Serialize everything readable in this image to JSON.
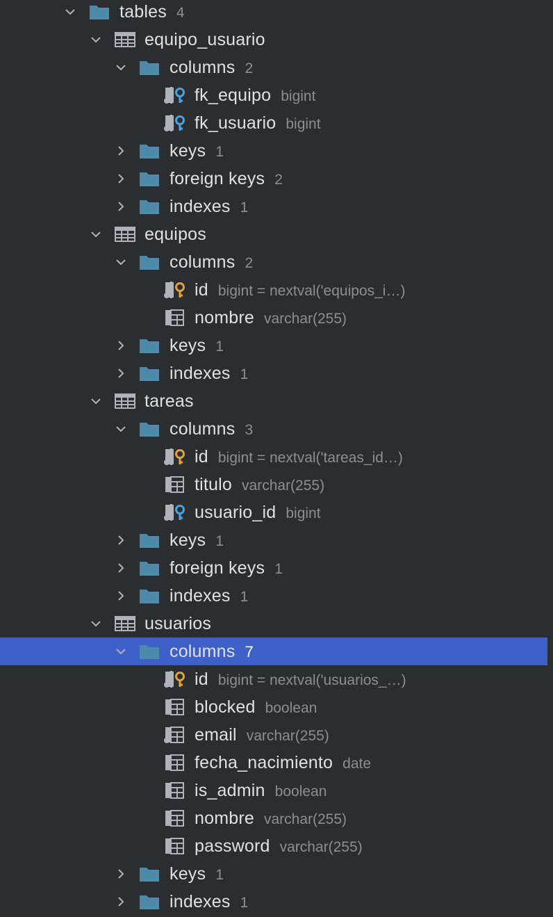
{
  "tree": [
    {
      "level": 0,
      "kind": "folder",
      "expanded": true,
      "name": "tables",
      "meta": "4"
    },
    {
      "level": 1,
      "kind": "table",
      "expanded": true,
      "name": "equipo_usuario",
      "meta": ""
    },
    {
      "level": 2,
      "kind": "folder",
      "expanded": true,
      "name": "columns",
      "meta": "2"
    },
    {
      "level": 3,
      "kind": "col-fk",
      "name": "fk_equipo",
      "meta": "bigint"
    },
    {
      "level": 3,
      "kind": "col-fk",
      "name": "fk_usuario",
      "meta": "bigint"
    },
    {
      "level": 2,
      "kind": "folder",
      "expanded": false,
      "name": "keys",
      "meta": "1"
    },
    {
      "level": 2,
      "kind": "folder",
      "expanded": false,
      "name": "foreign keys",
      "meta": "2"
    },
    {
      "level": 2,
      "kind": "folder",
      "expanded": false,
      "name": "indexes",
      "meta": "1"
    },
    {
      "level": 1,
      "kind": "table",
      "expanded": true,
      "name": "equipos",
      "meta": ""
    },
    {
      "level": 2,
      "kind": "folder",
      "expanded": true,
      "name": "columns",
      "meta": "2"
    },
    {
      "level": 3,
      "kind": "col-pk",
      "name": "id",
      "meta": "bigint = nextval('equipos_i…)"
    },
    {
      "level": 3,
      "kind": "col",
      "name": "nombre",
      "meta": "varchar(255)"
    },
    {
      "level": 2,
      "kind": "folder",
      "expanded": false,
      "name": "keys",
      "meta": "1"
    },
    {
      "level": 2,
      "kind": "folder",
      "expanded": false,
      "name": "indexes",
      "meta": "1"
    },
    {
      "level": 1,
      "kind": "table",
      "expanded": true,
      "name": "tareas",
      "meta": ""
    },
    {
      "level": 2,
      "kind": "folder",
      "expanded": true,
      "name": "columns",
      "meta": "3"
    },
    {
      "level": 3,
      "kind": "col-pk",
      "name": "id",
      "meta": "bigint = nextval('tareas_id…)"
    },
    {
      "level": 3,
      "kind": "col",
      "name": "titulo",
      "meta": "varchar(255)"
    },
    {
      "level": 3,
      "kind": "col-fk",
      "name": "usuario_id",
      "meta": "bigint"
    },
    {
      "level": 2,
      "kind": "folder",
      "expanded": false,
      "name": "keys",
      "meta": "1"
    },
    {
      "level": 2,
      "kind": "folder",
      "expanded": false,
      "name": "foreign keys",
      "meta": "1"
    },
    {
      "level": 2,
      "kind": "folder",
      "expanded": false,
      "name": "indexes",
      "meta": "1"
    },
    {
      "level": 1,
      "kind": "table",
      "expanded": true,
      "name": "usuarios",
      "meta": ""
    },
    {
      "level": 2,
      "kind": "folder",
      "expanded": true,
      "name": "columns",
      "meta": "7",
      "selected": true
    },
    {
      "level": 3,
      "kind": "col-pk",
      "name": "id",
      "meta": "bigint = nextval('usuarios_…)"
    },
    {
      "level": 3,
      "kind": "col",
      "name": "blocked",
      "meta": "boolean"
    },
    {
      "level": 3,
      "kind": "col-idx",
      "name": "email",
      "meta": "varchar(255)"
    },
    {
      "level": 3,
      "kind": "col",
      "name": "fecha_nacimiento",
      "meta": "date"
    },
    {
      "level": 3,
      "kind": "col",
      "name": "is_admin",
      "meta": "boolean"
    },
    {
      "level": 3,
      "kind": "col",
      "name": "nombre",
      "meta": "varchar(255)"
    },
    {
      "level": 3,
      "kind": "col",
      "name": "password",
      "meta": "varchar(255)"
    },
    {
      "level": 2,
      "kind": "folder",
      "expanded": false,
      "name": "keys",
      "meta": "1"
    },
    {
      "level": 2,
      "kind": "folder",
      "expanded": false,
      "name": "indexes",
      "meta": "1"
    }
  ],
  "colors": {
    "background": "#2b2d30",
    "selection": "#3d61c8",
    "folder": "#4d8aa8",
    "icon_gray": "#aeb3bb",
    "key_gold": "#e0a53a",
    "key_blue": "#4aa3df",
    "text": "#dfe1e5",
    "meta_text": "#8b8e94"
  },
  "icons": {
    "folder": "folder-icon",
    "table": "table-icon",
    "col": "column-icon",
    "col-pk": "primary-key-column-icon",
    "col-fk": "foreign-key-column-icon",
    "col-idx": "indexed-column-icon",
    "expanded": "chevron-down-icon",
    "collapsed": "chevron-right-icon"
  }
}
